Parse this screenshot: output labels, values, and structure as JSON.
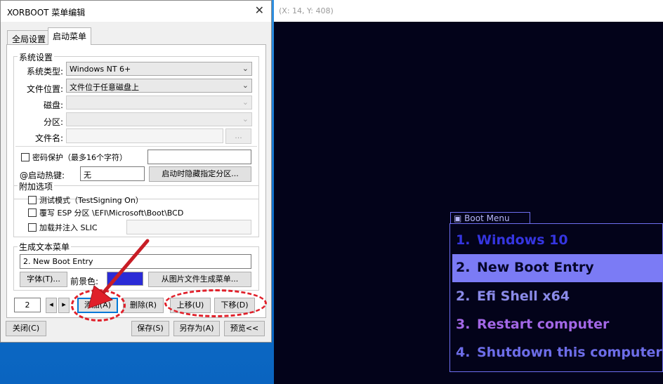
{
  "window": {
    "title": "XORBOOT 菜单编辑",
    "close_glyph": "✕"
  },
  "tabs": [
    {
      "label": "全局设置"
    },
    {
      "label": "启动菜单"
    }
  ],
  "system": {
    "group_title": "系统设置",
    "type_label": "系统类型:",
    "type_value": "Windows NT 6+",
    "location_label": "文件位置:",
    "location_value": "文件位于任意磁盘上",
    "disk_label": "磁盘:",
    "partition_label": "分区:",
    "filename_label": "文件名:",
    "browse_label": "..."
  },
  "password": {
    "label": "密码保护（最多16个字符）"
  },
  "hotkey": {
    "label": "@启动热键:",
    "value": "无",
    "hide_partition_button": "启动时隐藏指定分区..."
  },
  "extras": {
    "group_title": "附加选项",
    "options": [
      "测试模式（TestSigning On）",
      "覆写 ESP 分区 \\EFI\\Microsoft\\Boot\\BCD",
      "加载并注入 SLIC"
    ]
  },
  "text_menu": {
    "group_title": "生成文本菜单",
    "entry_value": "2.  New Boot Entry",
    "font_button": "字体(T)...",
    "fg_label": "前景色:",
    "fg_color": "#2b2bd6",
    "from_image_button": "从图片文件生成菜单..."
  },
  "entry_controls": {
    "index_value": "2",
    "prev_glyph": "◂",
    "next_glyph": "▸",
    "add_button": "添加(A)",
    "delete_button": "删除(R)",
    "up_button": "上移(U)",
    "down_button": "下移(D)"
  },
  "footer": {
    "close_button": "关闭(C)",
    "save_button": "保存(S)",
    "save_as_button": "另存为(A)",
    "preview_button": "预览<<"
  },
  "preview": {
    "coords": "(X: 14, Y: 408)",
    "menu_title": "Boot Menu",
    "items": [
      {
        "num": "1.",
        "label": "Windows 10",
        "color": "#3535e0"
      },
      {
        "num": "2.",
        "label": "New Boot Entry",
        "color": "#06062a",
        "selected": true,
        "bg": "#7b7bf5"
      },
      {
        "num": "2.",
        "label": "Efi Shell x64",
        "color": "#8a8ae8"
      },
      {
        "num": "3.",
        "label": "Restart computer",
        "color": "#a367e6"
      },
      {
        "num": "4.",
        "label": "Shutdown this computer",
        "color": "#6d6de8"
      }
    ]
  },
  "annotation": {
    "callout_color": "#e0202a"
  }
}
